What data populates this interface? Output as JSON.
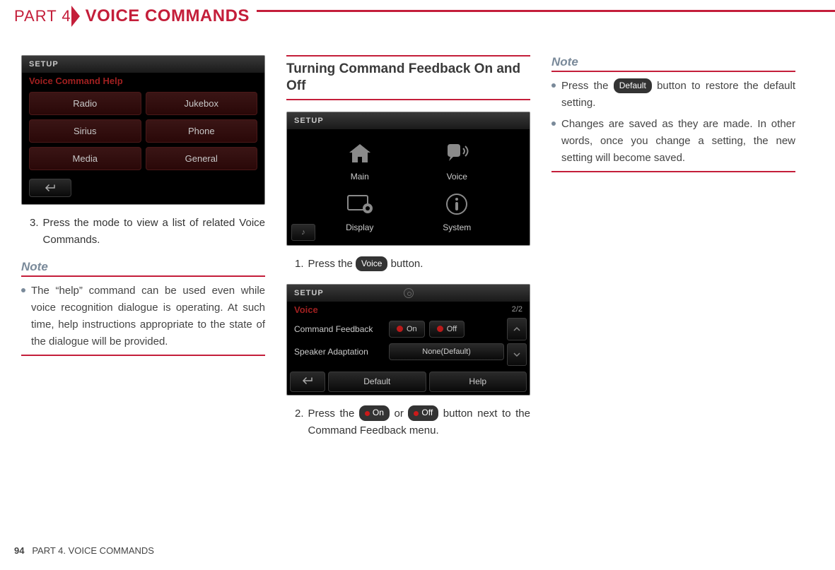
{
  "header": {
    "part": "PART 4",
    "title": "VOICE COMMANDS"
  },
  "col1": {
    "shot1": {
      "setup": "SETUP",
      "sub": "Voice Command Help",
      "buttons": [
        "Radio",
        "Jukebox",
        "Sirius",
        "Phone",
        "Media",
        "General"
      ]
    },
    "step3_num": "3.",
    "step3_txt": "Press the mode to view a list of related Voice Commands.",
    "note": "Note",
    "note_bullet": "The “help” command can be used even while voice recognition dialogue is operating. At such time, help instructions appropriate to the state of the dialogue will be provided."
  },
  "col2": {
    "heading": "Turning Command Feedback On and Off",
    "shot2": {
      "setup": "SETUP",
      "icons": {
        "main": "Main",
        "voice": "Voice",
        "display": "Display",
        "system": "System"
      }
    },
    "step1_num": "1.",
    "step1_pre": "Press the ",
    "step1_btn": "Voice",
    "step1_post": " button.",
    "shot3": {
      "setup": "SETUP",
      "title": "Voice",
      "page": "2/2",
      "row1": "Command Feedback",
      "r1_on": "On",
      "r1_off": "Off",
      "row2": "Speaker Adaptation",
      "r2_val": "None(Default)",
      "default": "Default",
      "help": "Help"
    },
    "step2_num": "2.",
    "step2_pre": "Press the ",
    "step2_on": "On",
    "step2_mid": " or ",
    "step2_off": "Off",
    "step2_post": " button next to the Command Feedback menu."
  },
  "col3": {
    "note": "Note",
    "b1_pre": "Press the ",
    "b1_btn": "Default",
    "b1_post": " button to restore the default setting.",
    "b2": "Changes are saved as they are made. In other words, once you change a setting, the new setting will become saved."
  },
  "footer": {
    "pn": "94",
    "txt": "PART 4. VOICE COMMANDS"
  }
}
